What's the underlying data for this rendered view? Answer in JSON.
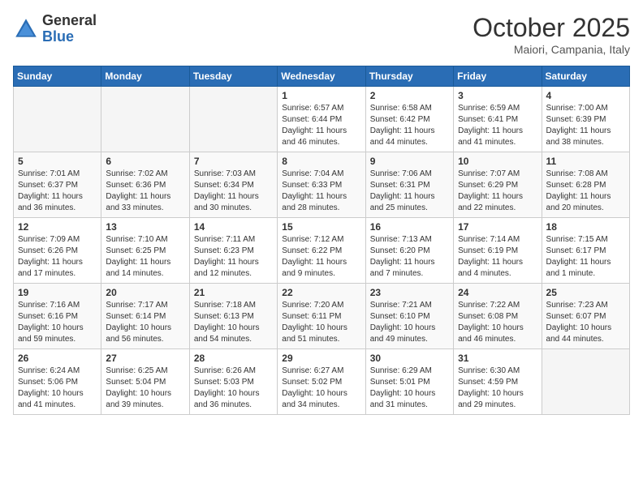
{
  "header": {
    "logo_general": "General",
    "logo_blue": "Blue",
    "month": "October 2025",
    "location": "Maiori, Campania, Italy"
  },
  "days_of_week": [
    "Sunday",
    "Monday",
    "Tuesday",
    "Wednesday",
    "Thursday",
    "Friday",
    "Saturday"
  ],
  "weeks": [
    [
      {
        "day": "",
        "info": ""
      },
      {
        "day": "",
        "info": ""
      },
      {
        "day": "",
        "info": ""
      },
      {
        "day": "1",
        "info": "Sunrise: 6:57 AM\nSunset: 6:44 PM\nDaylight: 11 hours\nand 46 minutes."
      },
      {
        "day": "2",
        "info": "Sunrise: 6:58 AM\nSunset: 6:42 PM\nDaylight: 11 hours\nand 44 minutes."
      },
      {
        "day": "3",
        "info": "Sunrise: 6:59 AM\nSunset: 6:41 PM\nDaylight: 11 hours\nand 41 minutes."
      },
      {
        "day": "4",
        "info": "Sunrise: 7:00 AM\nSunset: 6:39 PM\nDaylight: 11 hours\nand 38 minutes."
      }
    ],
    [
      {
        "day": "5",
        "info": "Sunrise: 7:01 AM\nSunset: 6:37 PM\nDaylight: 11 hours\nand 36 minutes."
      },
      {
        "day": "6",
        "info": "Sunrise: 7:02 AM\nSunset: 6:36 PM\nDaylight: 11 hours\nand 33 minutes."
      },
      {
        "day": "7",
        "info": "Sunrise: 7:03 AM\nSunset: 6:34 PM\nDaylight: 11 hours\nand 30 minutes."
      },
      {
        "day": "8",
        "info": "Sunrise: 7:04 AM\nSunset: 6:33 PM\nDaylight: 11 hours\nand 28 minutes."
      },
      {
        "day": "9",
        "info": "Sunrise: 7:06 AM\nSunset: 6:31 PM\nDaylight: 11 hours\nand 25 minutes."
      },
      {
        "day": "10",
        "info": "Sunrise: 7:07 AM\nSunset: 6:29 PM\nDaylight: 11 hours\nand 22 minutes."
      },
      {
        "day": "11",
        "info": "Sunrise: 7:08 AM\nSunset: 6:28 PM\nDaylight: 11 hours\nand 20 minutes."
      }
    ],
    [
      {
        "day": "12",
        "info": "Sunrise: 7:09 AM\nSunset: 6:26 PM\nDaylight: 11 hours\nand 17 minutes."
      },
      {
        "day": "13",
        "info": "Sunrise: 7:10 AM\nSunset: 6:25 PM\nDaylight: 11 hours\nand 14 minutes."
      },
      {
        "day": "14",
        "info": "Sunrise: 7:11 AM\nSunset: 6:23 PM\nDaylight: 11 hours\nand 12 minutes."
      },
      {
        "day": "15",
        "info": "Sunrise: 7:12 AM\nSunset: 6:22 PM\nDaylight: 11 hours\nand 9 minutes."
      },
      {
        "day": "16",
        "info": "Sunrise: 7:13 AM\nSunset: 6:20 PM\nDaylight: 11 hours\nand 7 minutes."
      },
      {
        "day": "17",
        "info": "Sunrise: 7:14 AM\nSunset: 6:19 PM\nDaylight: 11 hours\nand 4 minutes."
      },
      {
        "day": "18",
        "info": "Sunrise: 7:15 AM\nSunset: 6:17 PM\nDaylight: 11 hours\nand 1 minute."
      }
    ],
    [
      {
        "day": "19",
        "info": "Sunrise: 7:16 AM\nSunset: 6:16 PM\nDaylight: 10 hours\nand 59 minutes."
      },
      {
        "day": "20",
        "info": "Sunrise: 7:17 AM\nSunset: 6:14 PM\nDaylight: 10 hours\nand 56 minutes."
      },
      {
        "day": "21",
        "info": "Sunrise: 7:18 AM\nSunset: 6:13 PM\nDaylight: 10 hours\nand 54 minutes."
      },
      {
        "day": "22",
        "info": "Sunrise: 7:20 AM\nSunset: 6:11 PM\nDaylight: 10 hours\nand 51 minutes."
      },
      {
        "day": "23",
        "info": "Sunrise: 7:21 AM\nSunset: 6:10 PM\nDaylight: 10 hours\nand 49 minutes."
      },
      {
        "day": "24",
        "info": "Sunrise: 7:22 AM\nSunset: 6:08 PM\nDaylight: 10 hours\nand 46 minutes."
      },
      {
        "day": "25",
        "info": "Sunrise: 7:23 AM\nSunset: 6:07 PM\nDaylight: 10 hours\nand 44 minutes."
      }
    ],
    [
      {
        "day": "26",
        "info": "Sunrise: 6:24 AM\nSunset: 5:06 PM\nDaylight: 10 hours\nand 41 minutes."
      },
      {
        "day": "27",
        "info": "Sunrise: 6:25 AM\nSunset: 5:04 PM\nDaylight: 10 hours\nand 39 minutes."
      },
      {
        "day": "28",
        "info": "Sunrise: 6:26 AM\nSunset: 5:03 PM\nDaylight: 10 hours\nand 36 minutes."
      },
      {
        "day": "29",
        "info": "Sunrise: 6:27 AM\nSunset: 5:02 PM\nDaylight: 10 hours\nand 34 minutes."
      },
      {
        "day": "30",
        "info": "Sunrise: 6:29 AM\nSunset: 5:01 PM\nDaylight: 10 hours\nand 31 minutes."
      },
      {
        "day": "31",
        "info": "Sunrise: 6:30 AM\nSunset: 4:59 PM\nDaylight: 10 hours\nand 29 minutes."
      },
      {
        "day": "",
        "info": ""
      }
    ]
  ]
}
